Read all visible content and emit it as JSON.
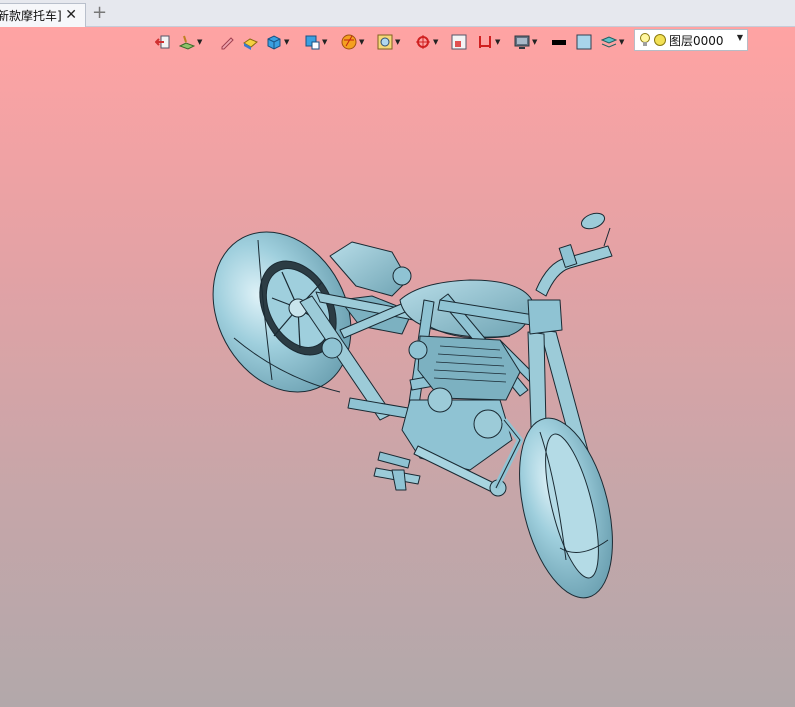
{
  "tab": {
    "title": "新款摩托车]",
    "close_glyph": "✕",
    "add_glyph": "+"
  },
  "toolbar": {
    "items": [
      {
        "name": "exit-icon"
      },
      {
        "name": "sketch-plane-icon"
      },
      {
        "name": "pencil-icon"
      },
      {
        "name": "eraser-icon"
      },
      {
        "name": "view-cube-icon"
      },
      {
        "name": "named-view-icon"
      },
      {
        "name": "render-style-icon"
      },
      {
        "name": "display-filter-icon"
      },
      {
        "name": "origin-axes-icon"
      },
      {
        "name": "zoom-box-icon"
      },
      {
        "name": "dimension-icon"
      },
      {
        "name": "monitor-icon"
      },
      {
        "name": "line-color-icon"
      },
      {
        "name": "fill-color-icon"
      },
      {
        "name": "layer-stack-icon"
      }
    ],
    "layer": {
      "name": "图层0000",
      "dropdown_glyph": "▼"
    }
  },
  "colors": {
    "background_top": "#ffa3a3",
    "background_bottom": "#b2a8aa",
    "model": "#8fc3d3",
    "model_edge": "#1a2a33"
  }
}
